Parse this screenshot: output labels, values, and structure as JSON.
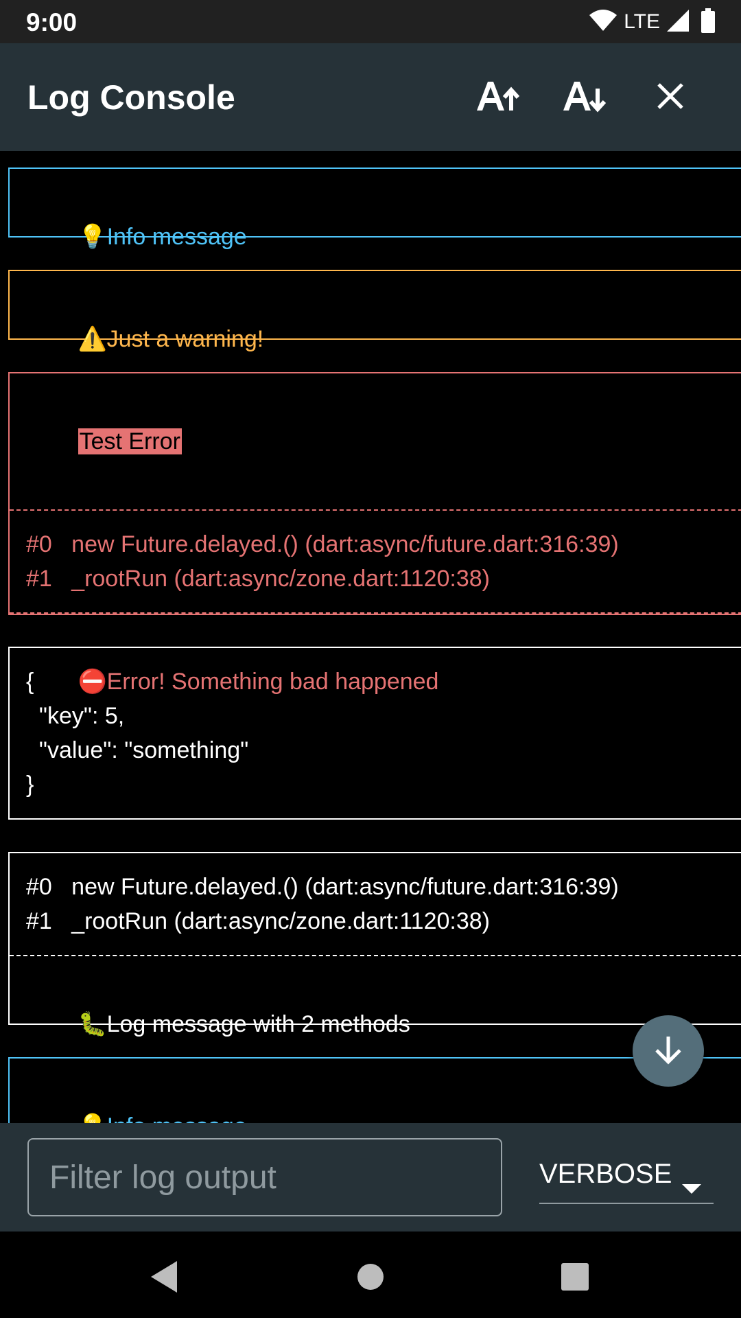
{
  "status_bar": {
    "time": "9:00",
    "network": "LTE",
    "icons": [
      "wifi-icon",
      "signal-icon",
      "battery-icon"
    ]
  },
  "app_bar": {
    "title": "Log Console",
    "actions": [
      "font-increase-icon",
      "font-decrease-icon",
      "close-icon"
    ]
  },
  "logs": {
    "info1": {
      "emoji": "💡",
      "text": "Info message"
    },
    "warning": {
      "emoji": "⚠️",
      "text": "Just a warning!"
    },
    "error": {
      "title": "Test Error",
      "stack": [
        "#0   new Future.delayed.() (dart:async/future.dart:316:39)",
        "#1   _rootRun (dart:async/zone.dart:1120:38)"
      ],
      "emoji": "⛔",
      "text": "Error! Something bad happened"
    },
    "json": {
      "lines": [
        "{",
        "  \"key\": 5,",
        "  \"value\": \"something\"",
        "}"
      ]
    },
    "debug": {
      "stack": [
        "#0   new Future.delayed.() (dart:async/future.dart:316:39)",
        "#1   _rootRun (dart:async/zone.dart:1120:38)"
      ],
      "emoji": "🐛",
      "text": "Log message with 2 methods"
    },
    "info2": {
      "emoji": "💡",
      "text": "Info message"
    }
  },
  "filter": {
    "placeholder": "Filter log output",
    "value": "",
    "level": "VERBOSE"
  },
  "colors": {
    "info": "#4fc3f7",
    "warning": "#ffb74d",
    "error": "#e57373",
    "appbar": "#263238",
    "fab": "#546e7a"
  }
}
